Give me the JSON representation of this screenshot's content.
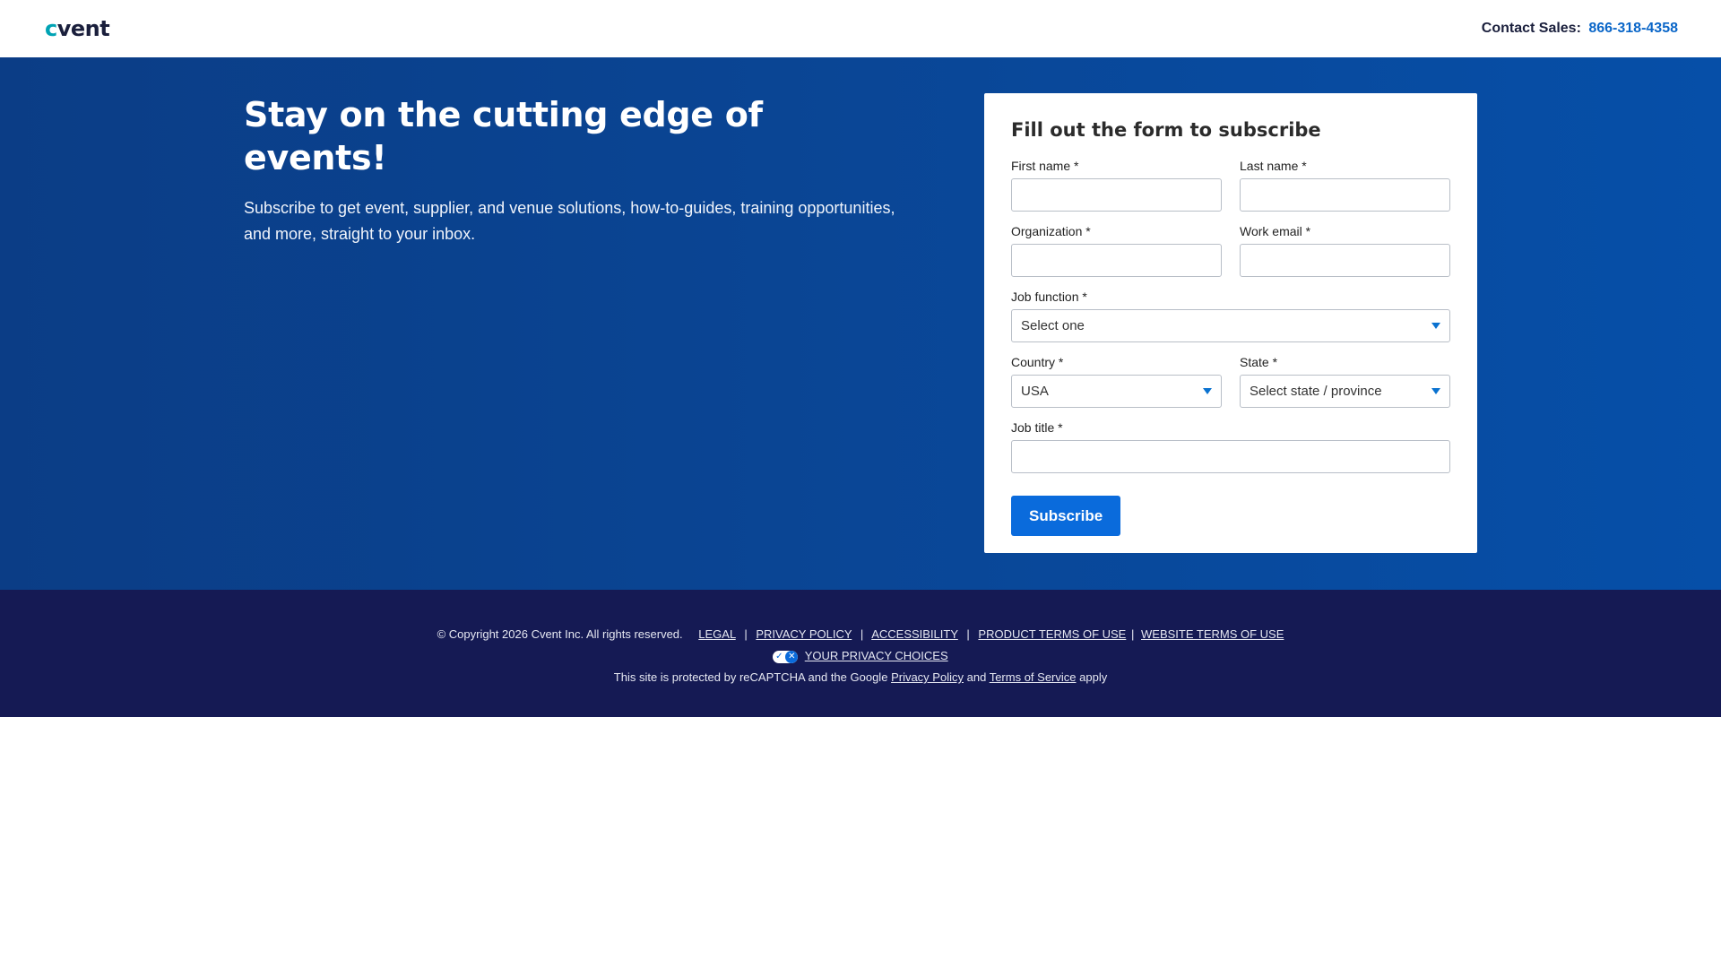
{
  "header": {
    "logo_c": "c",
    "logo_rest": "vent",
    "contact_label": "Contact Sales:",
    "contact_phone": "866-318-4358"
  },
  "hero": {
    "title": "Stay on the cutting edge of events!",
    "description": "Subscribe to get event, supplier, and venue solutions, how-to-guides, training opportunities, and more, straight to your inbox."
  },
  "form": {
    "title": "Fill out the form to subscribe",
    "first_name_label": "First name *",
    "first_name_value": "",
    "last_name_label": "Last name *",
    "last_name_value": "",
    "organization_label": "Organization *",
    "organization_value": "",
    "work_email_label": "Work email *",
    "work_email_value": "",
    "job_function_label": "Job function *",
    "job_function_value": "Select one",
    "country_label": "Country *",
    "country_value": "USA",
    "state_label": "State *",
    "state_value": "Select state / province",
    "job_title_label": "Job title *",
    "job_title_value": "",
    "submit_label": "Subscribe"
  },
  "footer": {
    "copyright": "© Copyright 2026 Cvent Inc. All rights reserved.",
    "links": [
      "LEGAL",
      "PRIVACY POLICY",
      "ACCESSIBILITY",
      "PRODUCT TERMS OF USE",
      "WEBSITE TERMS OF USE"
    ],
    "separator": "|",
    "privacy_choices": "YOUR PRIVACY CHOICES",
    "privacy_icon_left": "✓",
    "privacy_icon_right": "✕",
    "recaptcha_prefix": "This site is protected by reCAPTCHA and the Google",
    "recaptcha_privacy": "Privacy Policy",
    "recaptcha_and": "and",
    "recaptcha_terms": "Terms of Service",
    "recaptcha_suffix": "apply"
  },
  "colors": {
    "hero_bg": "#0b3d86",
    "footer_bg": "#151a54",
    "accent": "#0a6bdc",
    "logo_accent": "#00a3b4"
  }
}
